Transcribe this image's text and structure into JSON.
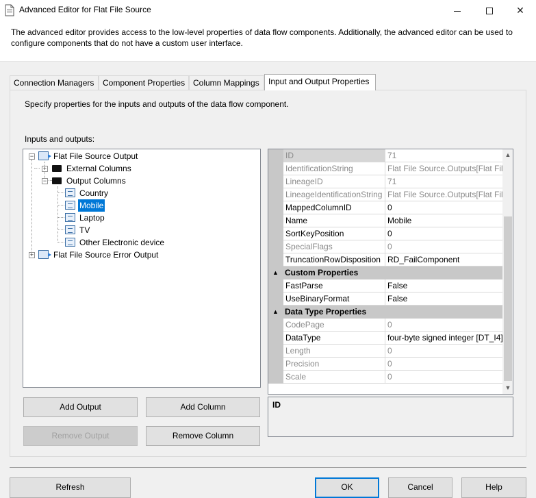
{
  "window": {
    "title": "Advanced Editor for Flat File Source",
    "minimize_icon": "minimize-icon",
    "maximize_icon": "maximize-icon",
    "close_icon": "close-icon",
    "close_glyph": "✕"
  },
  "header": {
    "description": "The advanced editor provides access to the low-level properties of data flow components. Additionally, the advanced editor can be used to configure components that do not have a custom user interface."
  },
  "tabs": [
    {
      "label": "Connection Managers",
      "active": false
    },
    {
      "label": "Component Properties",
      "active": false
    },
    {
      "label": "Column Mappings",
      "active": false
    },
    {
      "label": "Input and Output Properties",
      "active": true
    }
  ],
  "panel": {
    "description": "Specify properties for the inputs and outputs of the data flow component.",
    "io_label": "Inputs and outputs:"
  },
  "tree": {
    "nodes": [
      {
        "label": "Flat File Source Output",
        "icon": "output-icon",
        "expander": "−"
      },
      {
        "label": "External Columns",
        "icon": "folder-icon",
        "expander": "+"
      },
      {
        "label": "Output Columns",
        "icon": "folder-icon",
        "expander": "−"
      },
      {
        "label": "Country",
        "icon": "column-icon"
      },
      {
        "label": "Mobile",
        "icon": "column-icon",
        "selected": true
      },
      {
        "label": "Laptop",
        "icon": "column-icon"
      },
      {
        "label": "TV",
        "icon": "column-icon"
      },
      {
        "label": "Other Electronic device",
        "icon": "column-icon"
      },
      {
        "label": "Flat File Source Error Output",
        "icon": "output-icon",
        "expander": "+"
      }
    ]
  },
  "buttons": {
    "add_output": "Add Output",
    "add_column": "Add Column",
    "remove_output": "Remove Output",
    "remove_column": "Remove Column",
    "refresh": "Refresh",
    "ok": "OK",
    "cancel": "Cancel",
    "help": "Help"
  },
  "properties": {
    "rows": [
      {
        "name": "ID",
        "value": "71",
        "readonly": true
      },
      {
        "name": "IdentificationString",
        "value": "Flat File Source.Outputs[Flat File",
        "readonly": true
      },
      {
        "name": "LineageID",
        "value": "71",
        "readonly": true
      },
      {
        "name": "LineageIdentificationString",
        "value": "Flat File Source.Outputs[Flat File",
        "readonly": true
      },
      {
        "name": "MappedColumnID",
        "value": "0",
        "readonly": false
      },
      {
        "name": "Name",
        "value": "Mobile",
        "readonly": false
      },
      {
        "name": "SortKeyPosition",
        "value": "0",
        "readonly": false
      },
      {
        "name": "SpecialFlags",
        "value": "0",
        "readonly": true
      },
      {
        "name": "TruncationRowDisposition",
        "value": "RD_FailComponent",
        "readonly": false
      }
    ],
    "custom_category": "Custom Properties",
    "custom_rows": [
      {
        "name": "FastParse",
        "value": "False",
        "readonly": false
      },
      {
        "name": "UseBinaryFormat",
        "value": "False",
        "readonly": false
      }
    ],
    "datatype_category": "Data Type Properties",
    "datatype_rows": [
      {
        "name": "CodePage",
        "value": "0",
        "readonly": true
      },
      {
        "name": "DataType",
        "value": "four-byte signed integer [DT_I4]",
        "readonly": false
      },
      {
        "name": "Length",
        "value": "0",
        "readonly": true
      },
      {
        "name": "Precision",
        "value": "0",
        "readonly": true
      },
      {
        "name": "Scale",
        "value": "0",
        "readonly": true
      }
    ],
    "scroll_up": "▲",
    "scroll_down": "▼",
    "collapse_glyph": "▲"
  },
  "help_panel": {
    "title": "ID"
  }
}
